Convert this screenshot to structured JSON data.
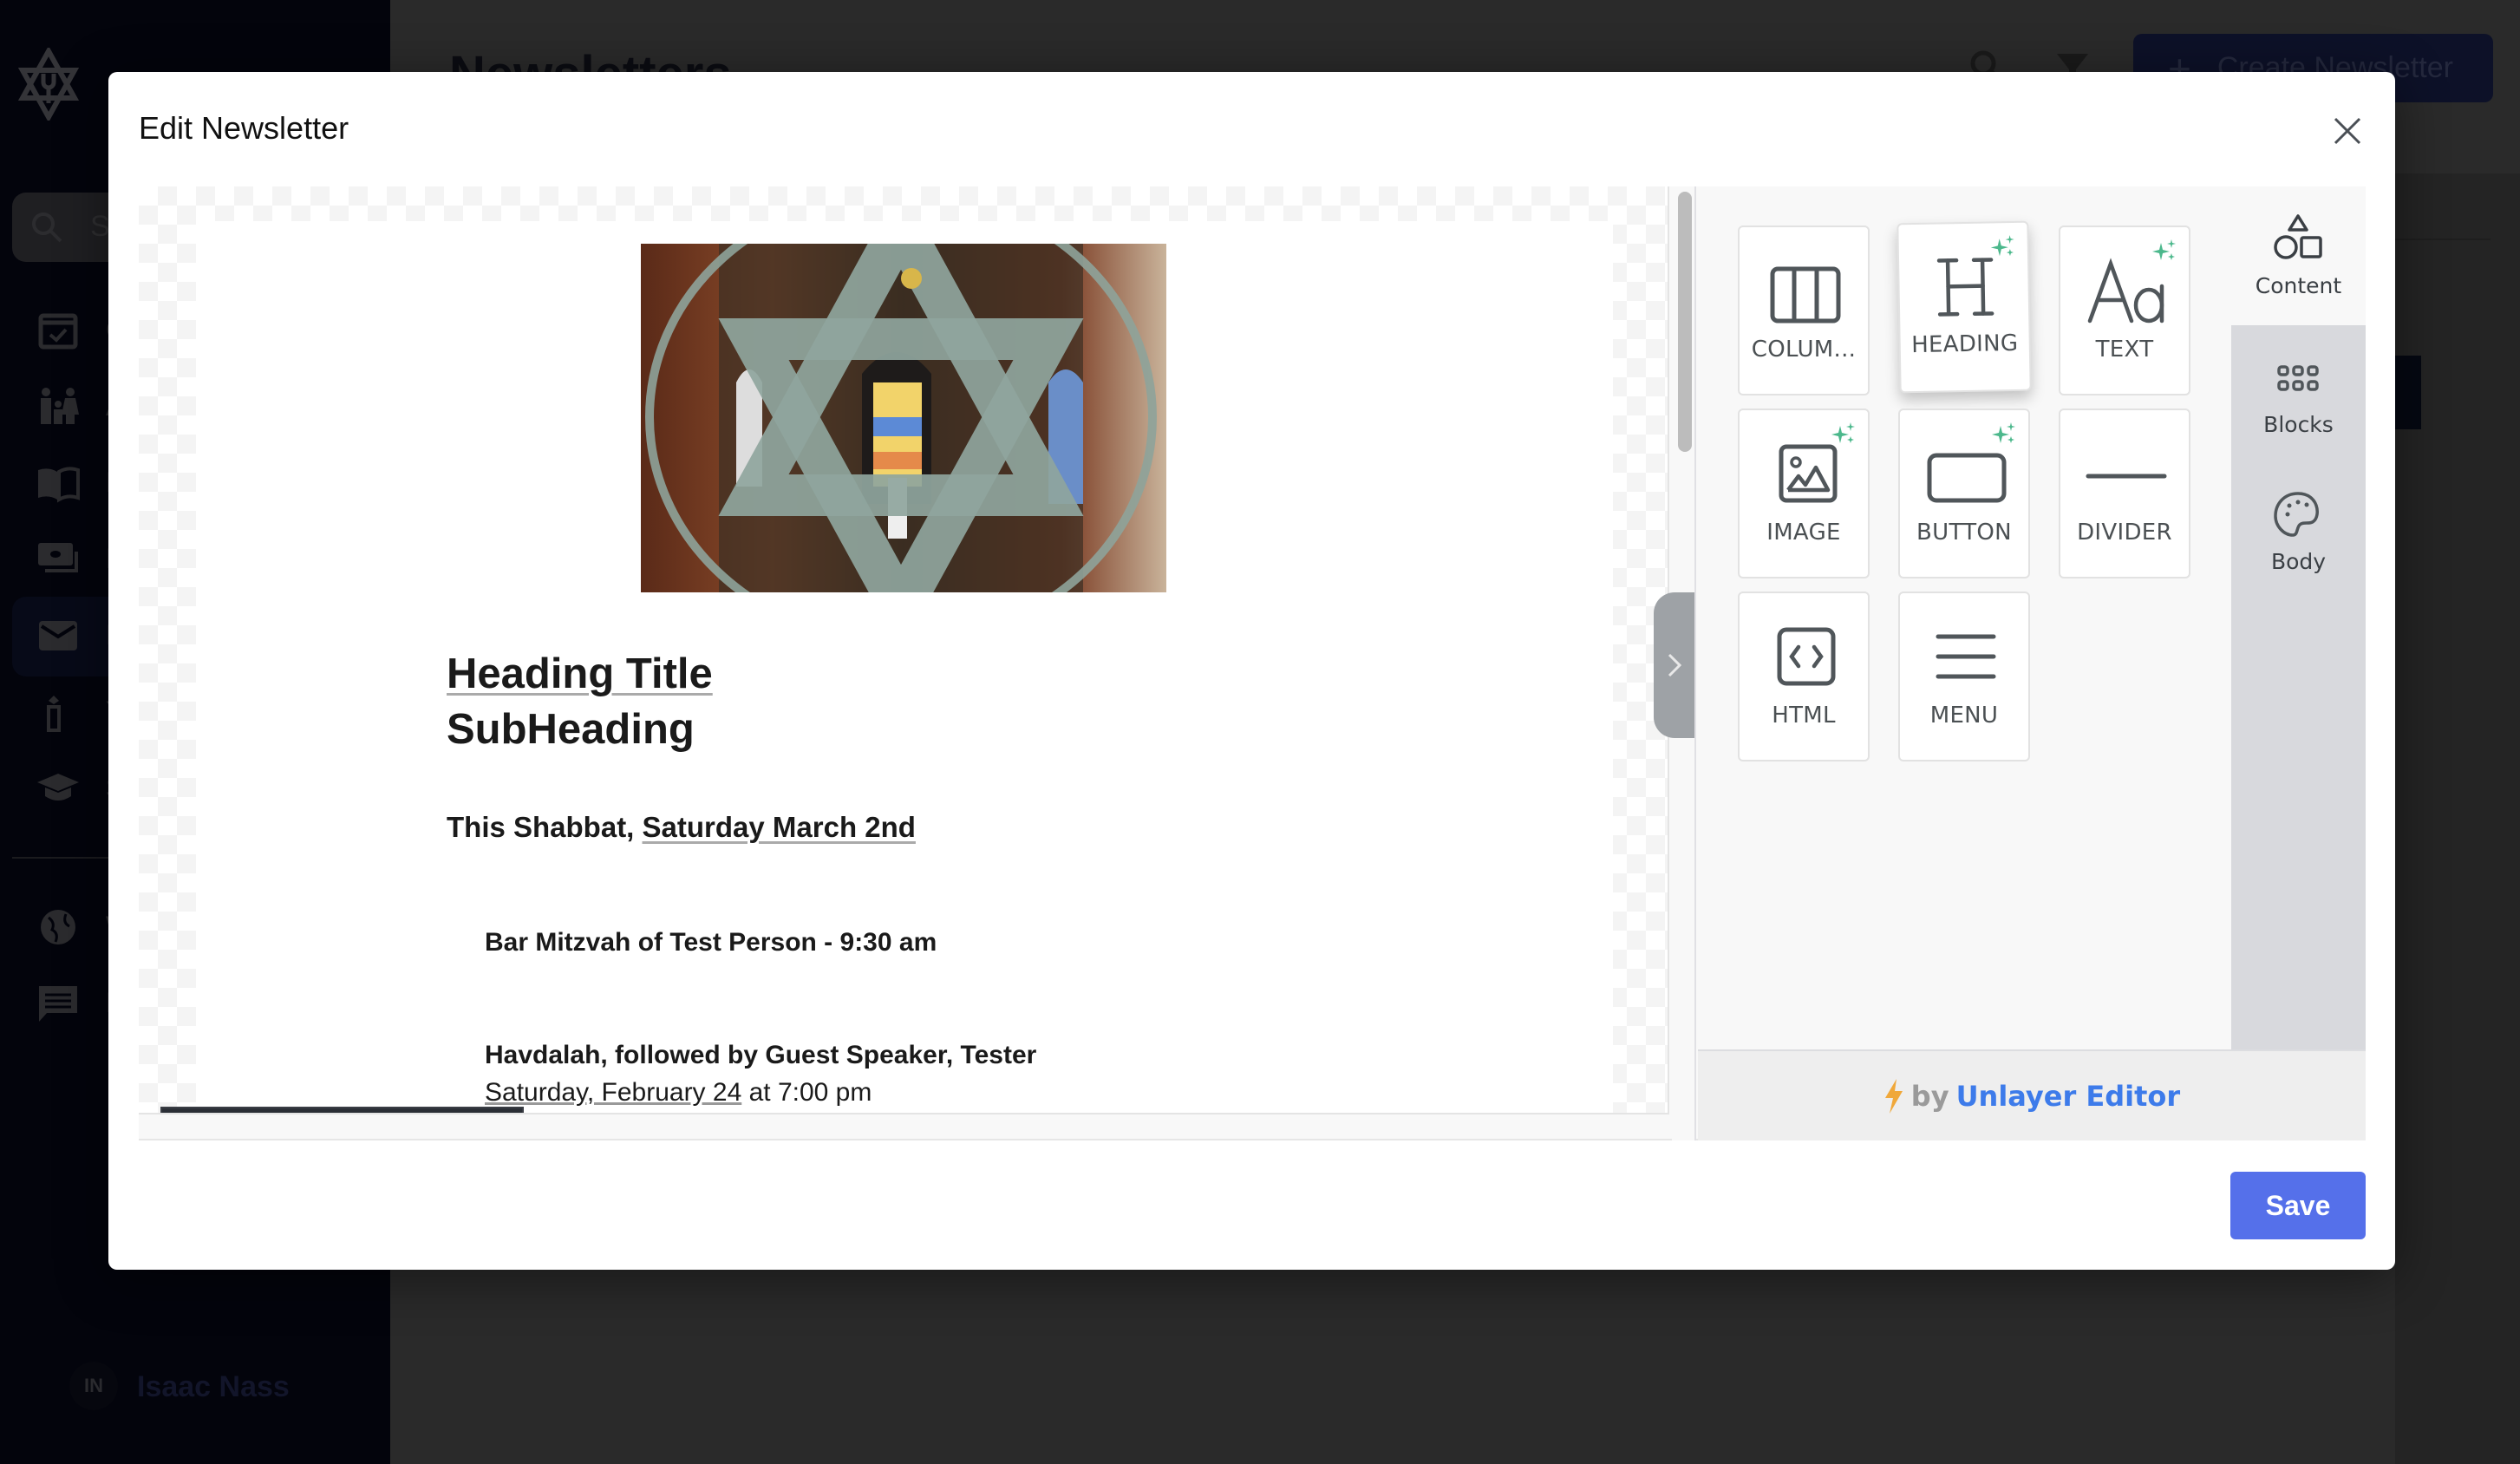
{
  "app": {
    "page_title": "Newsletters",
    "create_button_label": "Create Newsletter",
    "search_placeholder": "Search",
    "sidebar": {
      "items": [
        {
          "icon": "calendar-check-icon",
          "label": "Calendar"
        },
        {
          "icon": "family-icon",
          "label": "Accounts"
        },
        {
          "icon": "book-icon",
          "label": "Directory"
        },
        {
          "icon": "money-icon",
          "label": "Finances"
        },
        {
          "icon": "mail-icon",
          "label": "Newsletters",
          "active": true
        },
        {
          "icon": "candle-icon",
          "label": "Yahrzeits"
        },
        {
          "icon": "graduation-cap-icon",
          "label": "School"
        },
        {
          "icon": "globe-icon",
          "label": "Website"
        },
        {
          "icon": "chat-icon",
          "label": "Messages"
        }
      ],
      "user": {
        "initials": "IN",
        "name": "Isaac Nass"
      }
    }
  },
  "modal": {
    "title": "Edit Newsletter",
    "save_label": "Save",
    "email": {
      "heading_title": "Heading Title",
      "subheading": "SubHeading",
      "shabbat_prefix": "This Shabbat, ",
      "shabbat_date": "Saturday March 2nd",
      "bar_mitzvah": "Bar Mitzvah of Test Person - 9:30 am",
      "havdalah": "Havdalah, followed by Guest Speaker, Tester",
      "event_date_link": "Saturday, February 24",
      "event_time": " at 7:00 pm"
    },
    "toolbar": {
      "undo": "undo-icon",
      "redo": "redo-icon",
      "preview": "eye-icon",
      "desktop": "desktop-icon",
      "mobile": "mobile-icon"
    },
    "tools": [
      {
        "label": "COLUM...",
        "icon": "columns-icon",
        "ai": false
      },
      {
        "label": "HEADING",
        "icon": "heading-icon",
        "ai": true
      },
      {
        "label": "TEXT",
        "icon": "text-icon",
        "ai": true
      },
      {
        "label": "IMAGE",
        "icon": "image-icon",
        "ai": true
      },
      {
        "label": "BUTTON",
        "icon": "button-icon",
        "ai": true
      },
      {
        "label": "DIVIDER",
        "icon": "divider-icon",
        "ai": false
      },
      {
        "label": "HTML",
        "icon": "html-icon",
        "ai": false
      },
      {
        "label": "MENU",
        "icon": "menu-icon",
        "ai": false
      }
    ],
    "tabs": [
      {
        "label": "Content",
        "icon": "shapes-icon",
        "active": true
      },
      {
        "label": "Blocks",
        "icon": "grid-icon",
        "active": false
      },
      {
        "label": "Body",
        "icon": "palette-icon",
        "active": false
      }
    ],
    "powered_by": {
      "by": "by",
      "brand": "Unlayer Editor"
    },
    "colors": {
      "accent": "#5570ea",
      "ai_spark": "#4cb88c",
      "brand_link": "#3d7bea",
      "bolt": "#f0a83a"
    }
  }
}
